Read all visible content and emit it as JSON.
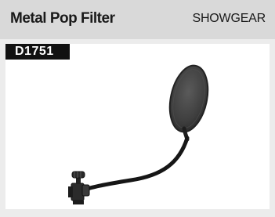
{
  "header": {
    "title": "Metal Pop Filter",
    "brand": "SHOWGEAR"
  },
  "product": {
    "code": "D1751"
  },
  "colors": {
    "header_bg": "#d9d9d9",
    "card_bg": "#ececec",
    "code_badge_bg": "#111111",
    "code_badge_text": "#ffffff"
  }
}
